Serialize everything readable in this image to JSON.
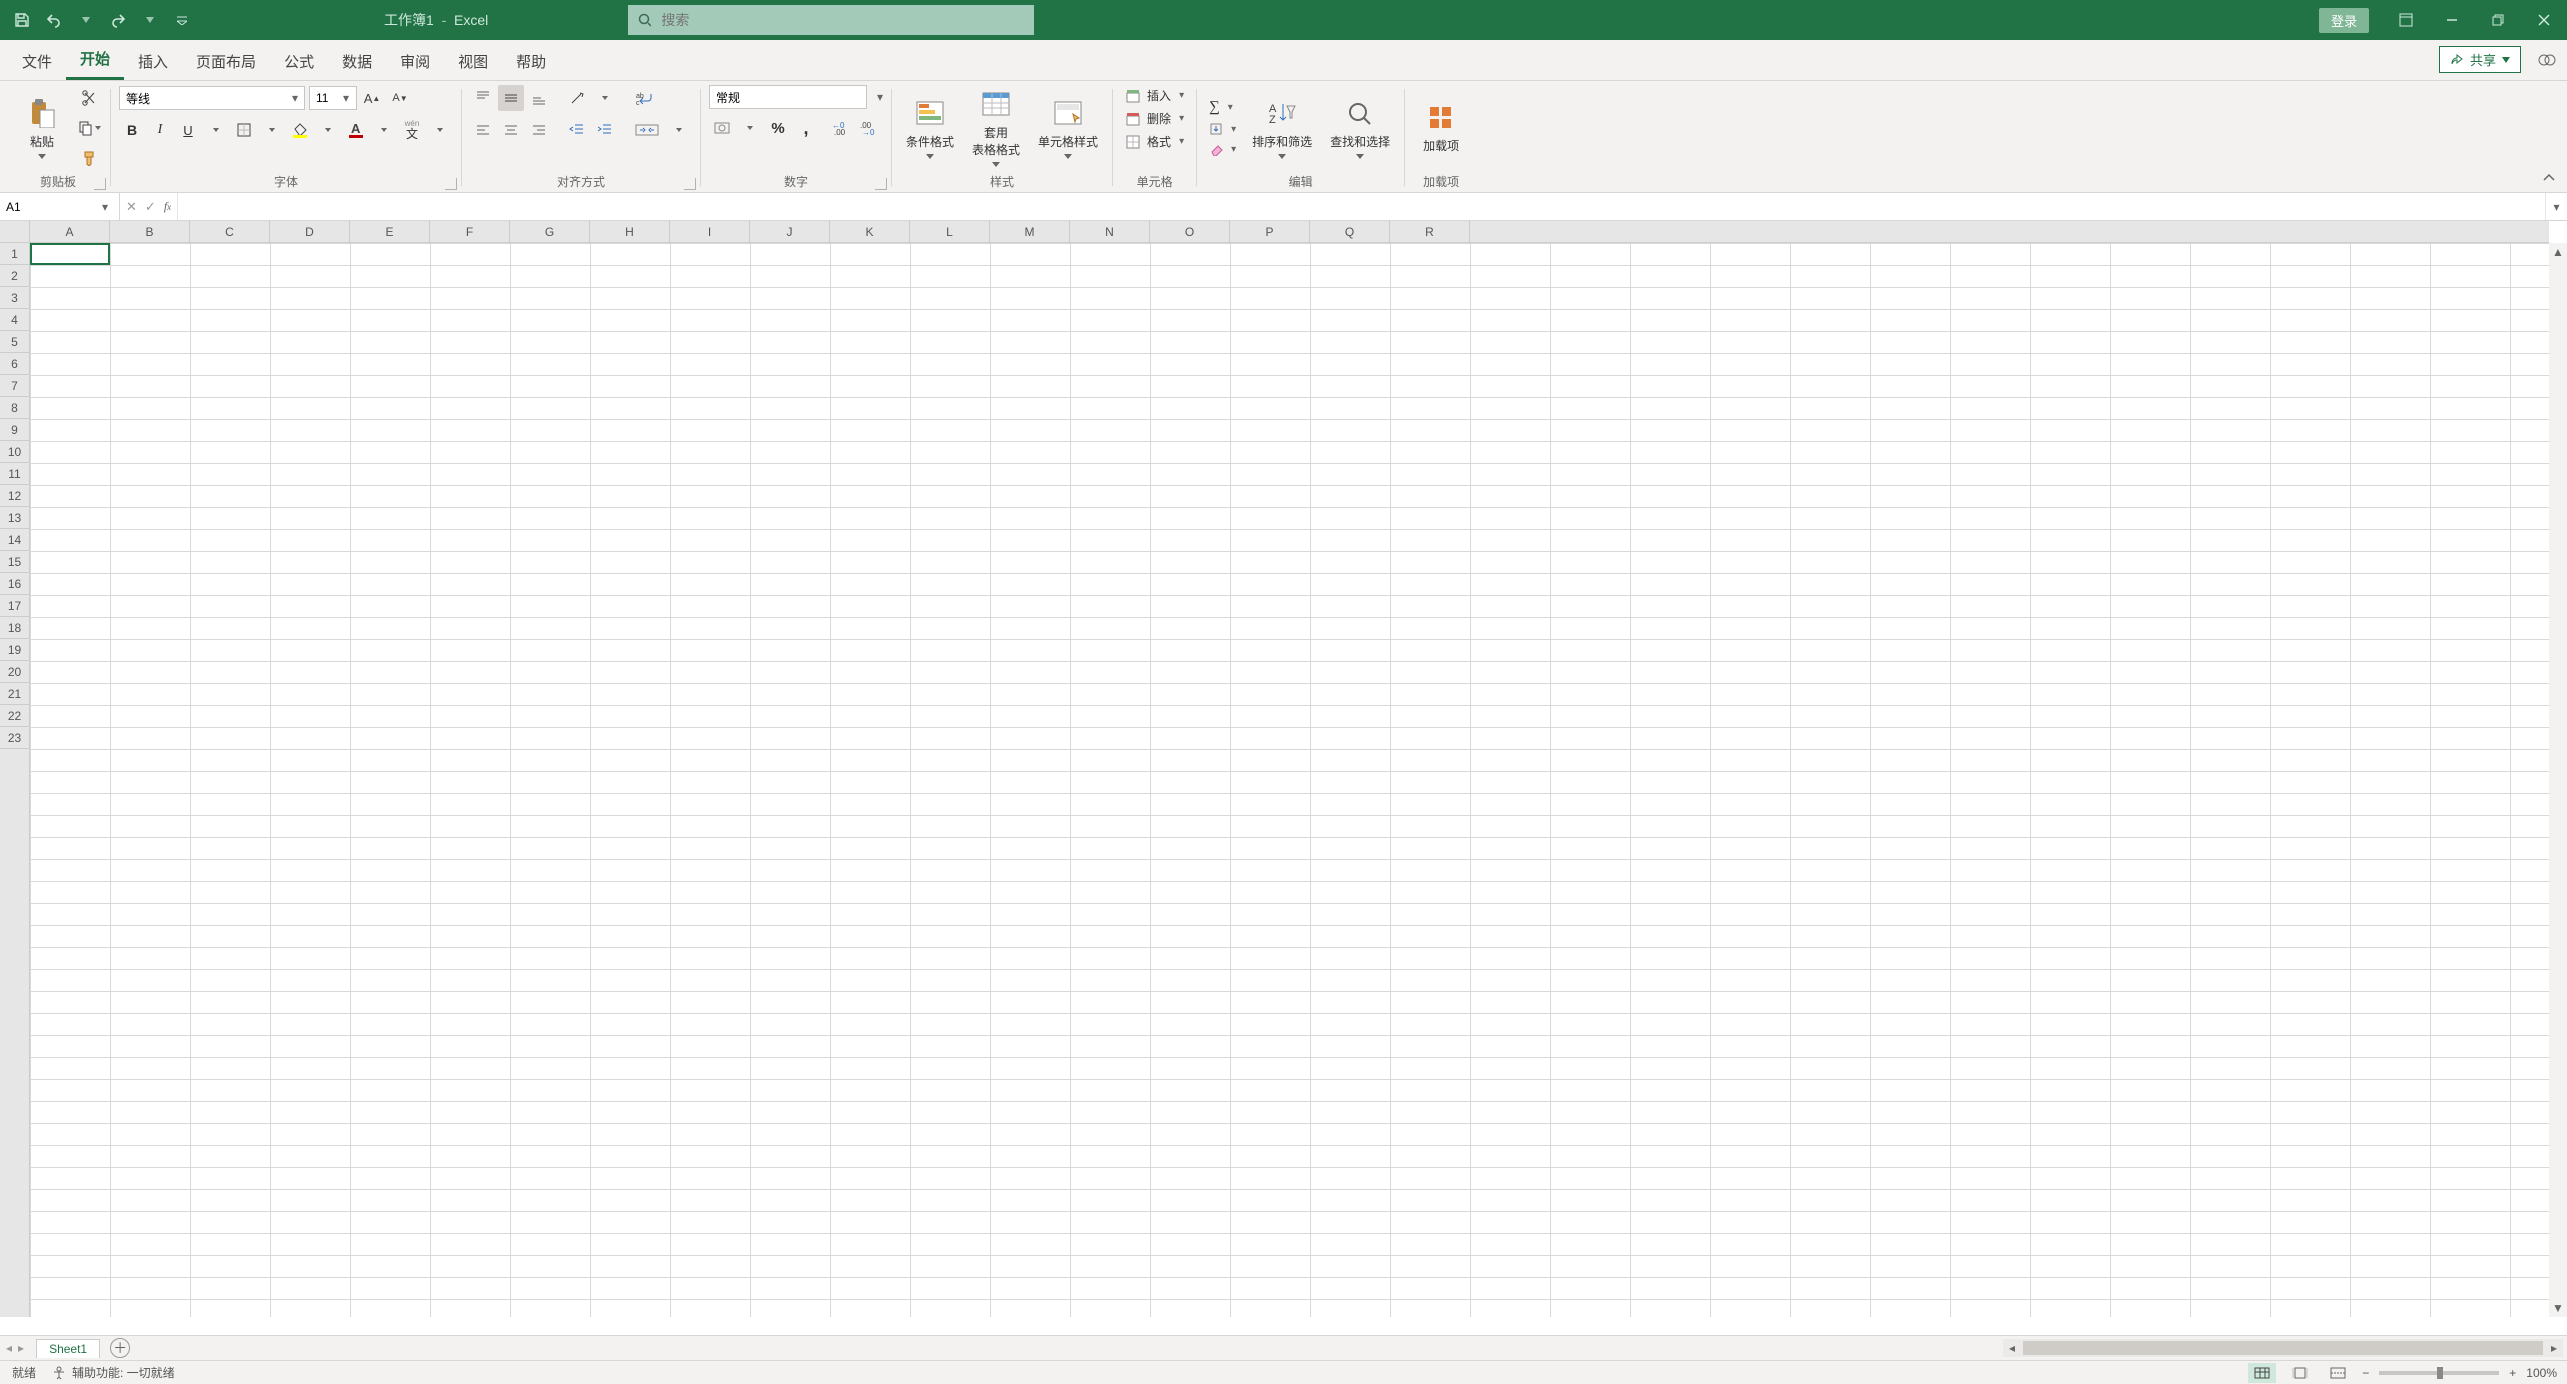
{
  "app": {
    "doc_title": "工作簿1",
    "app_name": "Excel"
  },
  "titlebar": {
    "login": "登录"
  },
  "search": {
    "placeholder": "搜索"
  },
  "tabs": {
    "file": "文件",
    "home": "开始",
    "insert": "插入",
    "pagelayout": "页面布局",
    "formulas": "公式",
    "data": "数据",
    "review": "审阅",
    "view": "视图",
    "help": "帮助",
    "share": "共享"
  },
  "ribbon": {
    "clipboard": {
      "paste": "粘贴",
      "label": "剪贴板"
    },
    "font": {
      "name": "等线",
      "size": "11",
      "wen": "wén",
      "label": "字体"
    },
    "align": {
      "label": "对齐方式"
    },
    "number": {
      "format": "常规",
      "label": "数字"
    },
    "styles": {
      "cond": "条件格式",
      "table": "套用\n表格格式",
      "cell": "单元格样式",
      "label": "样式"
    },
    "cells": {
      "insert": "插入",
      "delete": "删除",
      "format": "格式",
      "label": "单元格"
    },
    "editing": {
      "sort": "排序和筛选",
      "find": "查找和选择",
      "label": "编辑"
    },
    "addins": {
      "addin": "加载项",
      "label": "加载项"
    }
  },
  "namebox": {
    "value": "A1"
  },
  "columns": [
    "A",
    "B",
    "C",
    "D",
    "E",
    "F",
    "G",
    "H",
    "I",
    "J",
    "K",
    "L",
    "M",
    "N",
    "O",
    "P",
    "Q",
    "R"
  ],
  "rows": [
    "1",
    "2",
    "3",
    "4",
    "5",
    "6",
    "7",
    "8",
    "9",
    "10",
    "11",
    "12",
    "13",
    "14",
    "15",
    "16",
    "17",
    "18",
    "19",
    "20",
    "21",
    "22",
    "23"
  ],
  "sheets": {
    "sheet1": "Sheet1"
  },
  "status": {
    "ready": "就绪",
    "a11y": "辅助功能: 一切就绪",
    "zoom": "100%"
  }
}
